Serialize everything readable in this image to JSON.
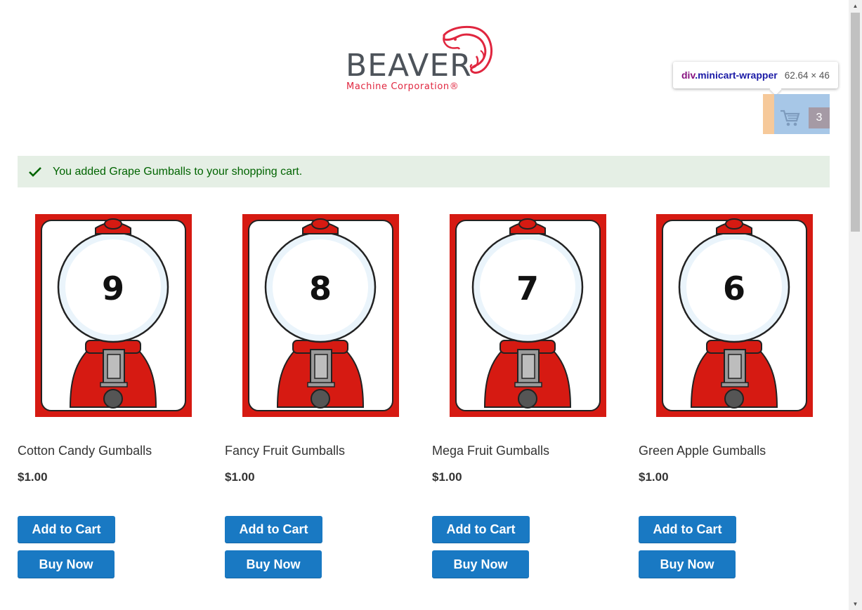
{
  "header": {
    "logo_word": "BEAVER",
    "logo_sub": "Machine Corporation®"
  },
  "devtools_tooltip": {
    "tag": "div",
    "class_name": ".minicart-wrapper",
    "dimensions": "62.64 × 46"
  },
  "minicart": {
    "icon": "cart-icon",
    "count": "3"
  },
  "message": {
    "icon": "check-icon",
    "text": "You added Grape Gumballs to your shopping cart."
  },
  "products": [
    {
      "name": "Cotton Candy Gumballs",
      "price": "$1.00",
      "number": "9",
      "add_label": "Add to Cart",
      "buy_label": "Buy Now"
    },
    {
      "name": "Fancy Fruit Gumballs",
      "price": "$1.00",
      "number": "8",
      "add_label": "Add to Cart",
      "buy_label": "Buy Now"
    },
    {
      "name": "Mega Fruit Gumballs",
      "price": "$1.00",
      "number": "7",
      "add_label": "Add to Cart",
      "buy_label": "Buy Now"
    },
    {
      "name": "Green Apple Gumballs",
      "price": "$1.00",
      "number": "6",
      "add_label": "Add to Cart",
      "buy_label": "Buy Now"
    }
  ],
  "colors": {
    "primary_button": "#1979c3",
    "success_bg": "#e5efe5",
    "success_text": "#006400",
    "brand_red": "#e0263f",
    "gumball_red": "#d61a12"
  },
  "scrollbar": {
    "up_icon": "scroll-up-arrow-icon",
    "down_icon": "scroll-down-arrow-icon"
  }
}
